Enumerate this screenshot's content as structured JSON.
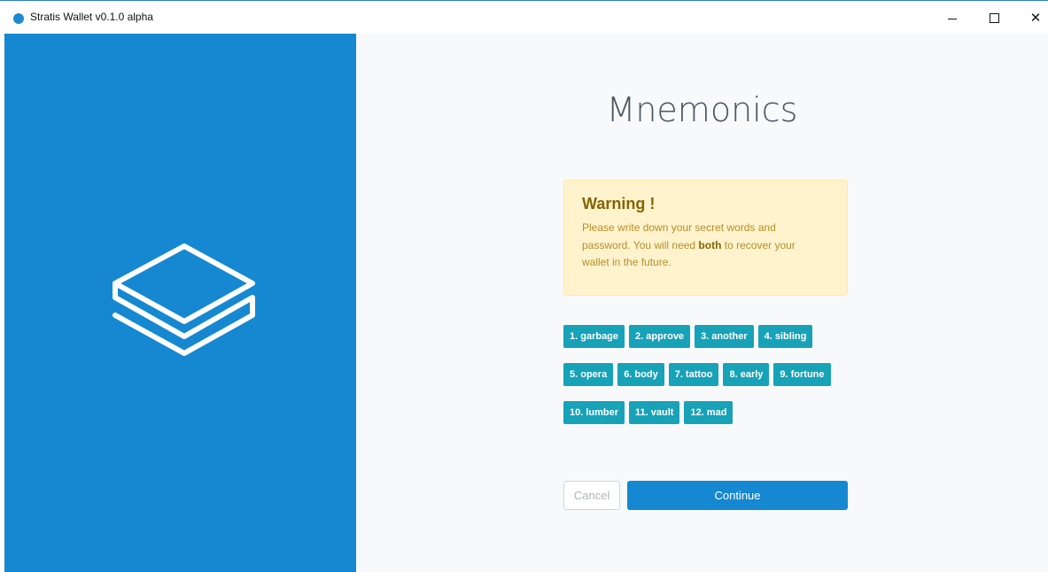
{
  "window": {
    "title": "Stratis Wallet v0.1.0 alpha",
    "icon": "stratis-logo-icon",
    "controls": {
      "minimize": "minimize-icon",
      "maximize": "maximize-icon",
      "close": "close-icon",
      "close_glyph": "✕"
    }
  },
  "sidebar": {
    "logo": "stratis-logo",
    "background": "#1588d1"
  },
  "main": {
    "title": "Mnemonics",
    "warning": {
      "title": "Warning !",
      "text_before": "Please write down your secret words and password. You will need ",
      "text_bold": "both",
      "text_after": " to recover your wallet in the future."
    },
    "words": [
      [
        "1. garbage",
        "2. approve",
        "3. another",
        "4. sibling"
      ],
      [
        "5. opera",
        "6. body",
        "7. tattoo",
        "8. early",
        "9. fortune"
      ],
      [
        "10. lumber",
        "11. vault",
        "12. mad"
      ]
    ],
    "buttons": {
      "cancel": "Cancel",
      "continue": "Continue"
    }
  },
  "colors": {
    "accent": "#1588d1",
    "word_badge": "#17a2b8",
    "warning_bg": "#fff3cd",
    "warning_title": "#856404"
  }
}
